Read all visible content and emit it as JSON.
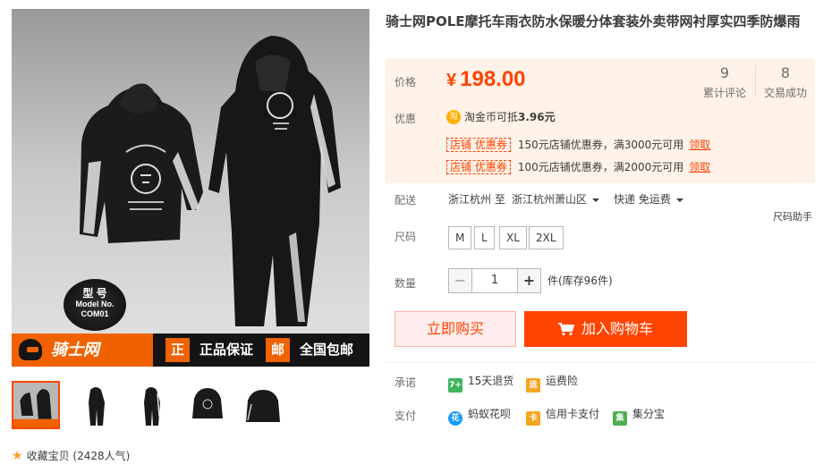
{
  "product": {
    "title": "骑士网POLE摩托车雨衣防水保暖分体套装外卖带网衬厚实四季防爆雨"
  },
  "gallery": {
    "model_badge": {
      "line1": "型 号",
      "line2": "Model No.",
      "line3": "COM01"
    },
    "banner": {
      "brand": "骑士网",
      "tag1_box": "正",
      "tag1_text": "正品保证",
      "tag2_box": "邮",
      "tag2_text": "全国包邮"
    },
    "thumbnails": [
      "thumb-1",
      "thumb-2",
      "thumb-3",
      "thumb-4",
      "thumb-5"
    ],
    "favorite": {
      "label": "收藏宝贝",
      "count": "(2428人气)"
    }
  },
  "price_panel": {
    "price_label": "价格",
    "currency": "¥",
    "price": "198.00",
    "reviews": {
      "num": "9",
      "label": "累计评论"
    },
    "sales": {
      "num": "8",
      "label": "交易成功"
    },
    "promo_label": "优惠",
    "taojin": {
      "icon": "淘",
      "text": "淘金币可抵",
      "amount": "3.96元"
    },
    "coupons": [
      {
        "tag": "店铺  优惠券",
        "text": "150元店铺优惠券，满3000元可用",
        "action": "领取"
      },
      {
        "tag": "店铺  优惠券",
        "text": "100元店铺优惠券，满2000元可用",
        "action": "领取"
      }
    ]
  },
  "delivery": {
    "label": "配送",
    "from": "浙江杭州 至",
    "to": "浙江杭州萧山区",
    "method": "快递 免运费"
  },
  "size": {
    "label": "尺码",
    "guide": "尺码助手",
    "options": [
      "M",
      "L",
      "XL",
      "2XL"
    ]
  },
  "quantity": {
    "label": "数量",
    "minus": "−",
    "value": "1",
    "plus": "+",
    "unit_stock": "件(库存96件)"
  },
  "actions": {
    "buy_now": "立即购买",
    "add_cart": "加入购物车"
  },
  "services": {
    "promise_label": "承诺",
    "promise_items": [
      {
        "icon": "7+",
        "text": "15天退货",
        "color": "#3eb55e"
      },
      {
        "icon": "运",
        "text": "运费险",
        "color": "#f5a623"
      }
    ],
    "pay_label": "支付",
    "pay_items": [
      {
        "icon": "花",
        "text": "蚂蚁花呗",
        "color": "#1a9bfc"
      },
      {
        "icon": "卡",
        "text": "信用卡支付",
        "color": "#f5a623"
      },
      {
        "icon": "集",
        "text": "集分宝",
        "color": "#4caf50"
      }
    ]
  },
  "colors": {
    "accent": "#ff4400",
    "panel_bg": "#fff2e8",
    "banner_orange": "#f06200"
  }
}
